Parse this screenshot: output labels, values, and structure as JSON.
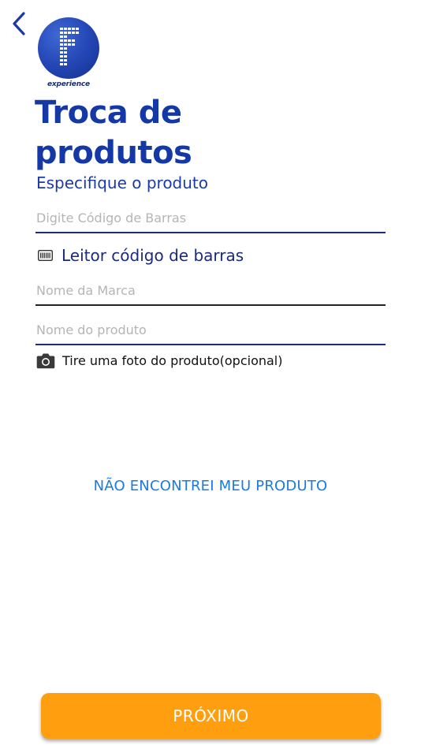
{
  "header": {
    "back_icon": "chevron-left-icon",
    "logo_caption": "experience",
    "title": "Troca de produtos",
    "subtitle": "Especifique o produto"
  },
  "form": {
    "barcode_placeholder": "Digite Código de Barras",
    "barcode_value": "",
    "barcode_reader_label": "Leitor código de barras",
    "barcode_reader_icon": "barcode-scanner-icon",
    "brand_placeholder": "Nome da Marca",
    "brand_value": "",
    "product_placeholder": "Nome do produto",
    "product_value": "",
    "photo_label": "Tire uma foto do produto(opcional)",
    "photo_icon": "camera-icon"
  },
  "actions": {
    "not_found_label": "NÃO ENCONTREI MEU PRODUTO",
    "next_label": "PRÓXIMO"
  },
  "colors": {
    "primary_blue": "#1438a6",
    "link_blue": "#1a7be0",
    "button_orange": "#ff9f0f",
    "underline_dark": "#1b2a7a",
    "underline_black": "#222222"
  }
}
